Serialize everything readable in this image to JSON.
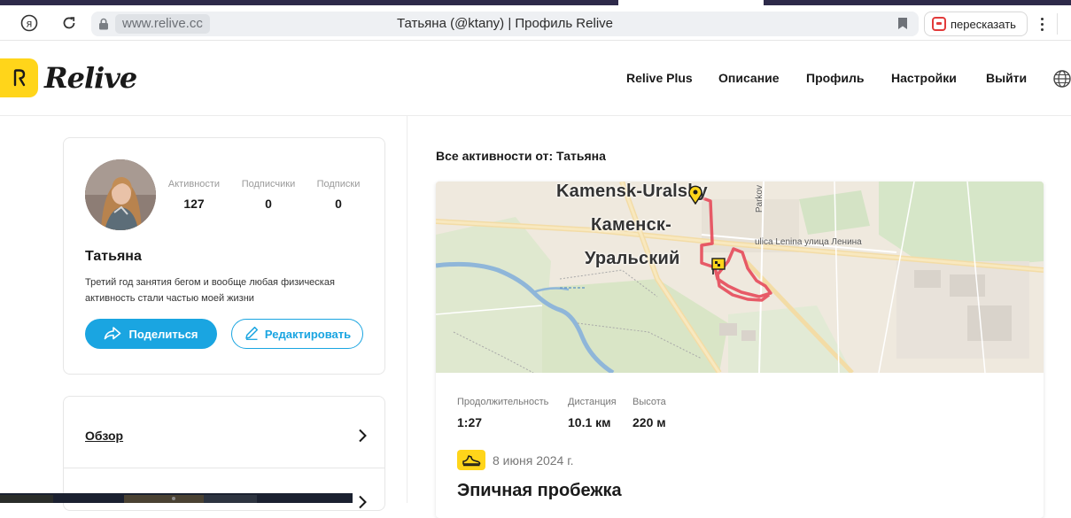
{
  "browser": {
    "url": "www.relive.cc",
    "page_title": "Татьяна (@ktany) | Профиль Relive",
    "retell_label": "пересказать"
  },
  "header": {
    "logo_text": "Relive",
    "nav": [
      "Relive Plus",
      "Описание",
      "Профиль",
      "Настройки",
      "Выйти"
    ]
  },
  "profile": {
    "stats": [
      {
        "label": "Активности",
        "value": "127"
      },
      {
        "label": "Подписчики",
        "value": "0"
      },
      {
        "label": "Подписки",
        "value": "0"
      }
    ],
    "name": "Татьяна",
    "bio": "Третий год занятия бегом и вообще любая физическая активность стали частью моей жизни",
    "share_label": "Поделиться",
    "edit_label": "Редактировать"
  },
  "menu": {
    "items": [
      "Обзор"
    ]
  },
  "feed": {
    "section_title": "Все активности от: Татьяна",
    "map": {
      "city_latin": "Kamensk-Uralsky",
      "city_ru_1": "Каменск-",
      "city_ru_2": "Уральский",
      "street": "ulica Lenina улица Ленина",
      "park": "Parkov"
    },
    "metrics": [
      {
        "label": "Продолжительность",
        "value": "1:27"
      },
      {
        "label": "Дистанция",
        "value": "10.1 км"
      },
      {
        "label": "Высота",
        "value": "220 м"
      }
    ],
    "date": "8 июня 2024 г.",
    "title": "Эпичная пробежка"
  },
  "colors": {
    "brand_yellow": "#ffd51a",
    "accent_blue": "#1aa5e1",
    "route_red": "#e64a5a"
  },
  "icons": [
    "yandex-icon",
    "reload-icon",
    "lock-icon",
    "bookmark-icon",
    "retell-icon",
    "menu-dots-icon",
    "globe-icon",
    "share-icon",
    "pencil-icon",
    "chevron-right-icon",
    "sneaker-icon",
    "start-pin-icon",
    "finish-flag-icon"
  ]
}
